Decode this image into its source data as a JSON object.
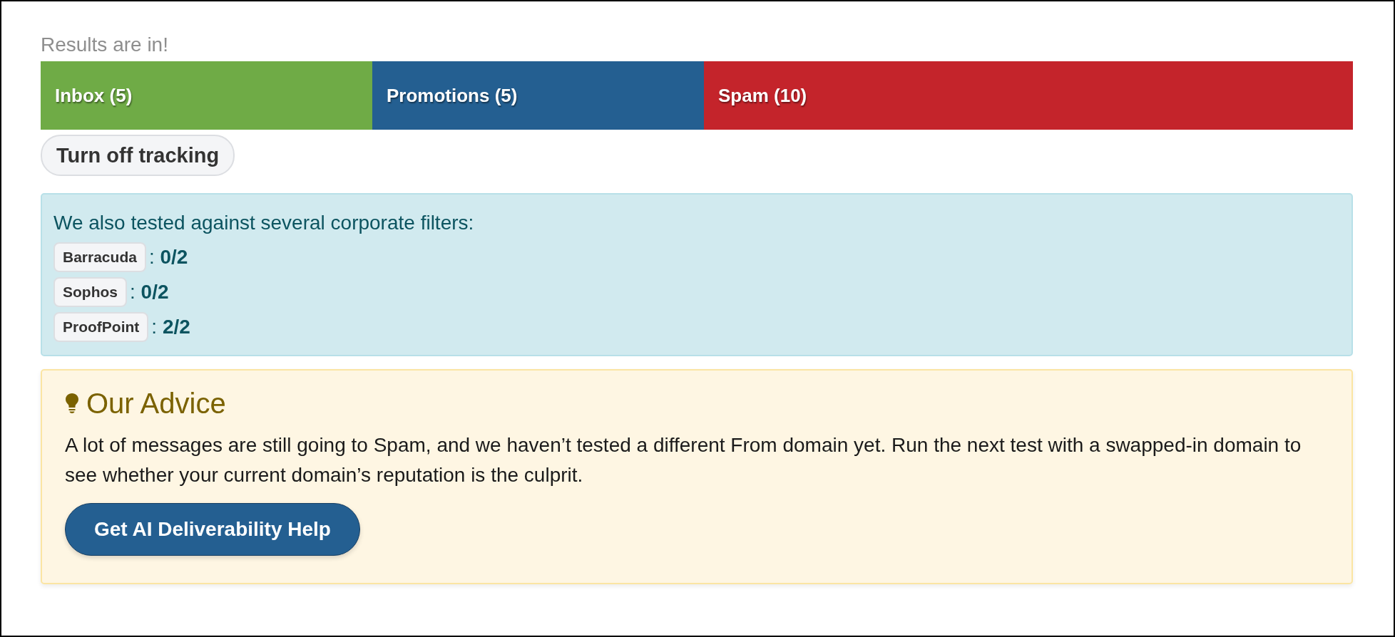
{
  "header": {
    "title": "Results are in!"
  },
  "results_bar": [
    {
      "label": "Inbox (5)",
      "color": "#6fab46"
    },
    {
      "label": "Promotions (5)",
      "color": "#245f91"
    },
    {
      "label": "Spam (10)",
      "color": "#c4242b"
    }
  ],
  "tracking_button": {
    "label": "Turn off tracking"
  },
  "corporate_filters": {
    "intro": "We also tested against several corporate filters:",
    "filters": [
      {
        "name": "Barracuda",
        "score": ": **0/2**"
      },
      {
        "name": "Sophos",
        "score": ": **0/2**"
      },
      {
        "name": "ProofPoint",
        "score": ": **2/2**"
      }
    ]
  },
  "advice": {
    "title": "Our Advice",
    "body": "A lot of messages are still going to Spam, and we haven’t tested a different From domain yet. Run the next test with a swapped-in domain to see whether your current domain’s reputation is the culprit.",
    "button": "Get AI Deliverability Help"
  }
}
